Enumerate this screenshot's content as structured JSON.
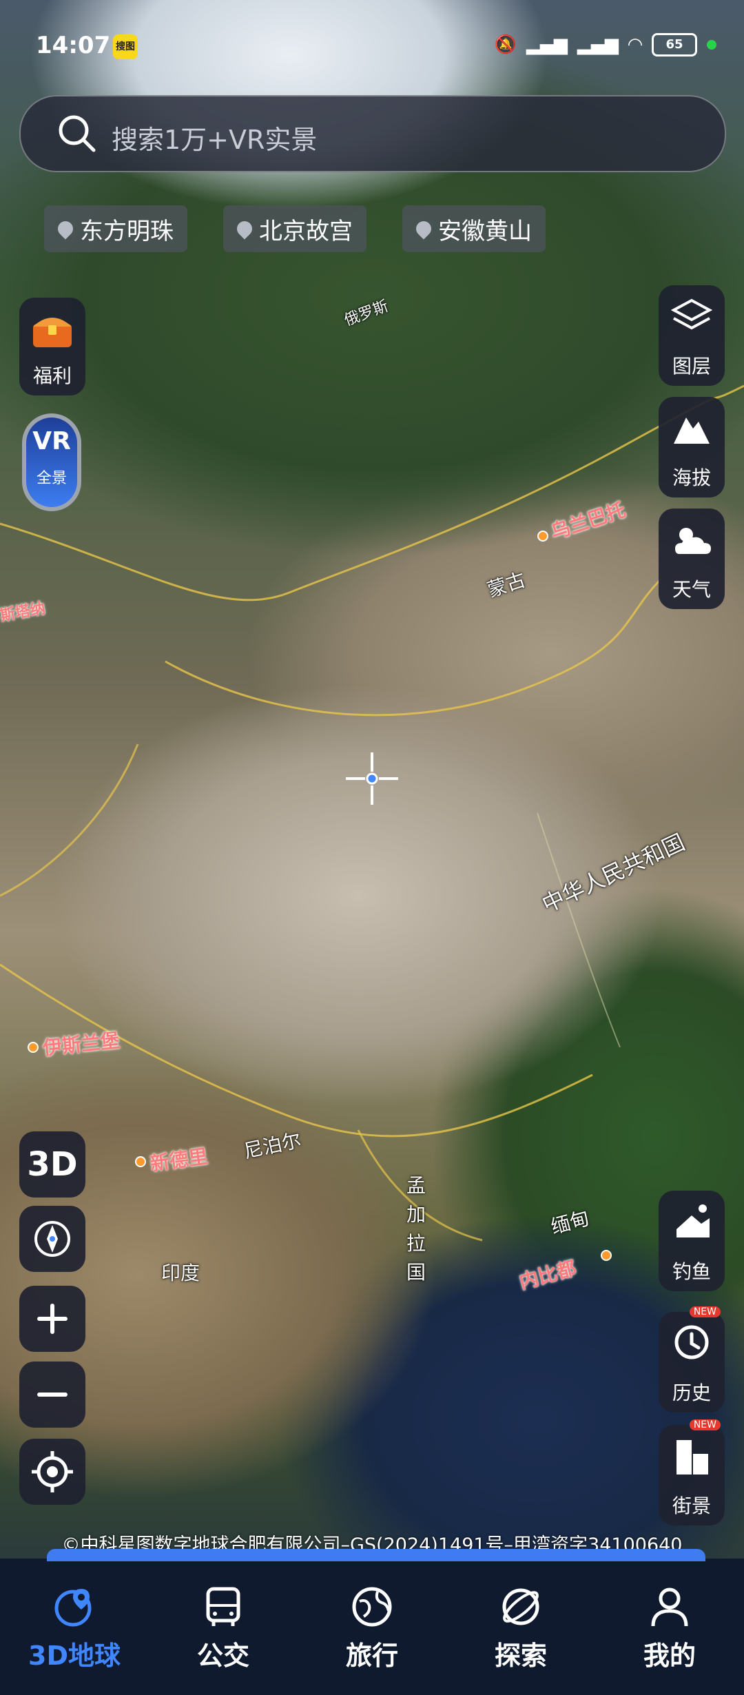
{
  "status_bar": {
    "time": "14:07",
    "app_badge": "搜图",
    "battery": "65"
  },
  "search": {
    "placeholder": "搜索1万+VR实景"
  },
  "quick_chips": [
    {
      "label": "东方明珠"
    },
    {
      "label": "北京故宫"
    },
    {
      "label": "安徽黄山"
    }
  ],
  "left_panel": {
    "welfare": "福利",
    "vr_top": "VR",
    "vr_bottom": "全景"
  },
  "right_panel": {
    "layers": "图层",
    "altitude": "海拔",
    "weather": "天气",
    "fishing": "钓鱼",
    "history": "历史",
    "street_view": "街景",
    "new_badge": "NEW"
  },
  "map_controls": {
    "mode_3d": "3D"
  },
  "map_labels": {
    "russia": "俄罗斯",
    "ulaanbaatar": "乌兰巴托",
    "mongolia": "蒙古",
    "astana_partial": "斯塔纳",
    "china": "中华人民共和国",
    "islamabad": "伊斯兰堡",
    "new_delhi": "新德里",
    "nepal": "尼泊尔",
    "bangladesh": "孟加拉国",
    "myanmar": "缅甸",
    "naypyidaw": "内比都",
    "india": "印度"
  },
  "copyright": "©中科星图数字地球合肥有限公司–GS(2024)1491号–甲湾资字34100640",
  "bottom_nav": [
    {
      "label": "3D地球",
      "active": true
    },
    {
      "label": "公交",
      "active": false
    },
    {
      "label": "旅行",
      "active": false
    },
    {
      "label": "探索",
      "active": false
    },
    {
      "label": "我的",
      "active": false
    }
  ],
  "colors": {
    "accent": "#3f86ff",
    "panel": "#1e2230",
    "city_label": "#ff7b7b"
  }
}
